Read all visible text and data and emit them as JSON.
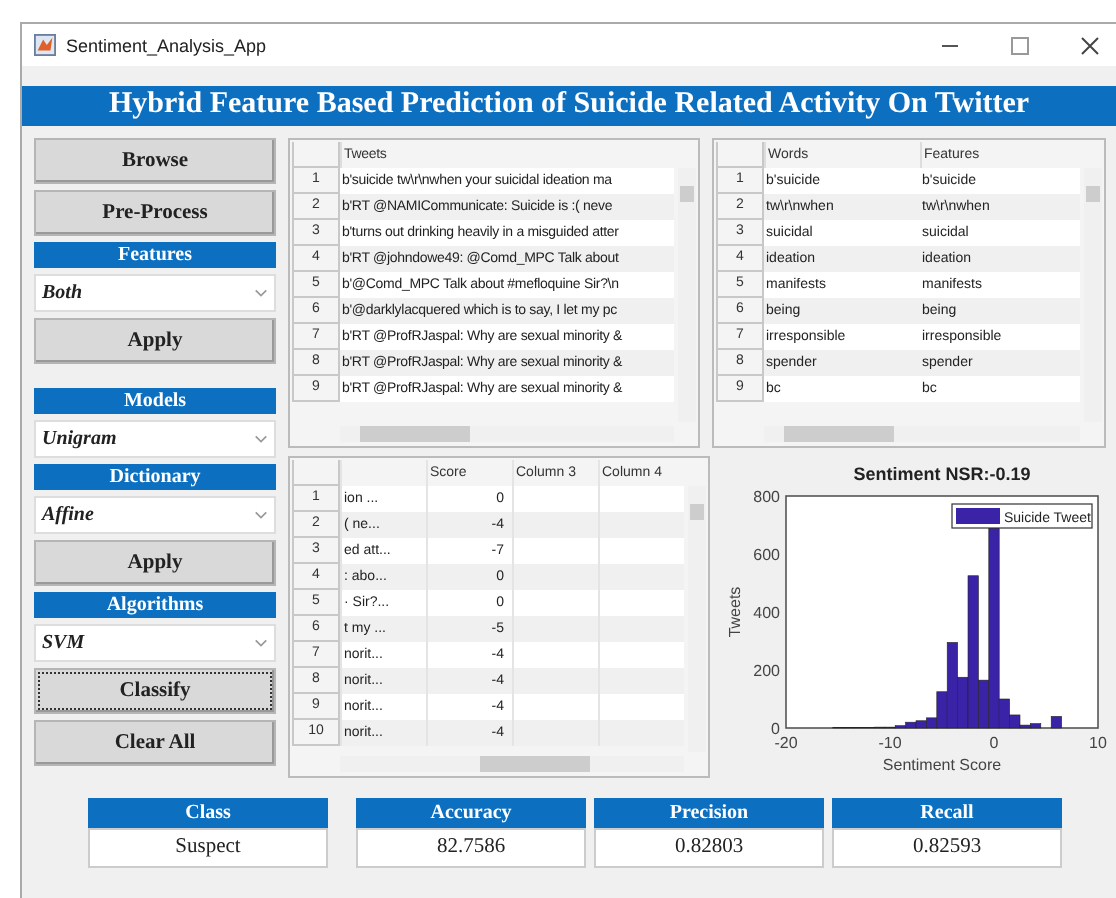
{
  "window": {
    "title": "Sentiment_Analysis_App"
  },
  "header": "Hybrid Feature Based Prediction of Suicide Related Activity On Twitter",
  "sidebar": {
    "groups": [
      [
        {
          "kind": "button",
          "label": "Browse",
          "focused": false
        },
        {
          "kind": "button",
          "label": "Pre-Process",
          "focused": false
        },
        {
          "kind": "heading",
          "label": "Features"
        },
        {
          "kind": "dropdown",
          "value": "Both"
        },
        {
          "kind": "button",
          "label": "Apply",
          "focused": false
        }
      ],
      [
        {
          "kind": "heading",
          "label": "Models"
        },
        {
          "kind": "dropdown",
          "value": "Unigram"
        },
        {
          "kind": "heading",
          "label": "Dictionary"
        },
        {
          "kind": "dropdown",
          "value": "Affine"
        },
        {
          "kind": "button",
          "label": "Apply",
          "focused": false
        },
        {
          "kind": "heading",
          "label": "Algorithms"
        },
        {
          "kind": "dropdown",
          "value": "SVM"
        },
        {
          "kind": "button",
          "label": "Classify",
          "focused": true
        },
        {
          "kind": "button",
          "label": "Clear All",
          "focused": false
        }
      ]
    ]
  },
  "tweets_table": {
    "columns": [
      {
        "heading": "Tweets"
      }
    ],
    "rows": [
      {
        "label": "1",
        "cells": [
          "b'suicide tw\\r\\nwhen your suicidal ideation ma"
        ]
      },
      {
        "label": "2",
        "cells": [
          "b'RT @NAMICommunicate: Suicide is :(  neve"
        ]
      },
      {
        "label": "3",
        "cells": [
          "b'turns out drinking heavily in a misguided atter"
        ]
      },
      {
        "label": "4",
        "cells": [
          "b'RT @johndowe49: @Comd_MPC Talk about"
        ]
      },
      {
        "label": "5",
        "cells": [
          "b'@Comd_MPC Talk about #mefloquine Sir?\\n"
        ]
      },
      {
        "label": "6",
        "cells": [
          "b'@darklylacquered which is to say, I let my pc"
        ]
      },
      {
        "label": "7",
        "cells": [
          "b'RT @ProfRJaspal: Why are sexual minority &"
        ]
      },
      {
        "label": "8",
        "cells": [
          "b'RT @ProfRJaspal: Why are sexual minority &"
        ]
      },
      {
        "label": "9",
        "cells": [
          "b'RT @ProfRJaspal: Why are sexual minority &"
        ]
      }
    ]
  },
  "words_table": {
    "columns": [
      {
        "heading": "Words"
      },
      {
        "heading": "Features"
      }
    ],
    "rows": [
      {
        "label": "1",
        "cells": [
          "b'suicide",
          "b'suicide"
        ]
      },
      {
        "label": "2",
        "cells": [
          "tw\\r\\nwhen",
          "tw\\r\\nwhen"
        ]
      },
      {
        "label": "3",
        "cells": [
          "suicidal",
          "suicidal"
        ]
      },
      {
        "label": "4",
        "cells": [
          "ideation",
          "ideation"
        ]
      },
      {
        "label": "5",
        "cells": [
          "manifests",
          "manifests"
        ]
      },
      {
        "label": "6",
        "cells": [
          "being",
          "being"
        ]
      },
      {
        "label": "7",
        "cells": [
          "irresponsible",
          "irresponsible"
        ]
      },
      {
        "label": "8",
        "cells": [
          "spender",
          "spender"
        ]
      },
      {
        "label": "9",
        "cells": [
          "bc",
          "bc"
        ]
      }
    ]
  },
  "score_table": {
    "columns": [
      {},
      {
        "heading": "Score"
      },
      {
        "heading": "Column 3"
      },
      {
        "heading": "Column 4"
      }
    ],
    "rows": [
      {
        "label": "1",
        "cells": [
          "ion ...",
          "0"
        ]
      },
      {
        "label": "2",
        "cells": [
          "(  ne...",
          "-4"
        ]
      },
      {
        "label": "3",
        "cells": [
          "ed att...",
          "-7"
        ]
      },
      {
        "label": "4",
        "cells": [
          ": abo...",
          "0"
        ]
      },
      {
        "label": "5",
        "cells": [
          "· Sir?...",
          "0"
        ]
      },
      {
        "label": "6",
        "cells": [
          "t my ...",
          "-5"
        ]
      },
      {
        "label": "7",
        "cells": [
          "norit...",
          "-4"
        ]
      },
      {
        "label": "8",
        "cells": [
          "norit...",
          "-4"
        ]
      },
      {
        "label": "9",
        "cells": [
          "norit...",
          "-4"
        ]
      },
      {
        "label": "10",
        "cells": [
          "norit...",
          "-4"
        ]
      }
    ]
  },
  "histogram": {
    "chart_data": {
      "type": "bar",
      "title": "Sentiment NSR:-0.19",
      "xlabel": "Sentiment Score",
      "ylabel": "Tweets",
      "x": [
        -15,
        -14,
        -13,
        -12,
        -11,
        -10,
        -9,
        -8,
        -7,
        -6,
        -5,
        -4,
        -3,
        -2,
        -1,
        0,
        1,
        2,
        3,
        4,
        6
      ],
      "series": [
        {
          "name": "Suicide Tweet",
          "color": "#3b23a8",
          "values": [
            2,
            2,
            2,
            2,
            3,
            3,
            8,
            20,
            25,
            35,
            125,
            295,
            175,
            525,
            165,
            690,
            100,
            45,
            10,
            15,
            40
          ]
        }
      ],
      "xlim": [
        -20,
        10
      ],
      "ylim": [
        0,
        800
      ],
      "xticks": [
        -20,
        -10,
        0,
        10
      ],
      "yticks": [
        0,
        200,
        400,
        600,
        800
      ]
    }
  },
  "results": [
    {
      "label": "Class",
      "value": "Suspect"
    },
    {
      "label": "Accuracy",
      "value": "82.7586"
    },
    {
      "label": "Precision",
      "value": "0.82803"
    },
    {
      "label": "Recall",
      "value": "0.82593"
    }
  ]
}
